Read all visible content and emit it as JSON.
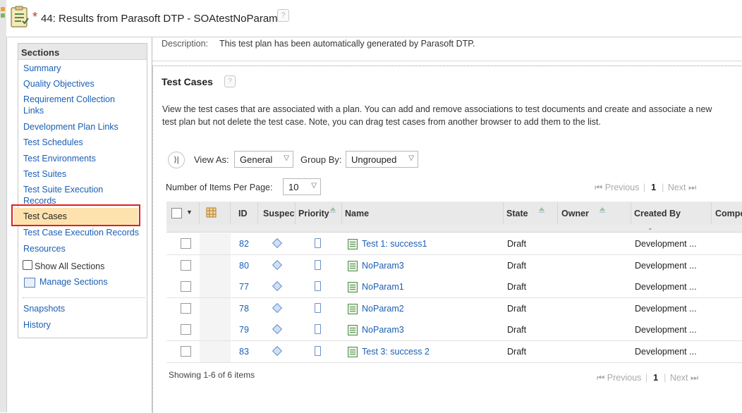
{
  "header": {
    "modified_mark": "*",
    "title": "44: Results from Parasoft DTP - SOAtestNoParam",
    "help": "?"
  },
  "sidebar": {
    "title": "Sections",
    "items": [
      {
        "label": "Summary"
      },
      {
        "label": "Quality Objectives"
      },
      {
        "label": "Requirement Collection"
      },
      {
        "label": "Links"
      },
      {
        "label": "Development Plan Links"
      },
      {
        "label": "Test Schedules"
      },
      {
        "label": "Test Environments"
      },
      {
        "label": "Test Suites"
      },
      {
        "label": "Test Suite Execution"
      },
      {
        "label": "Records"
      },
      {
        "label": "Test Cases"
      },
      {
        "label": "Test Case Execution Records"
      },
      {
        "label": "Resources"
      }
    ],
    "show_all": "Show All Sections",
    "manage": "Manage Sections",
    "snapshots": "Snapshots",
    "history": "History"
  },
  "description": {
    "label": "Description:",
    "text": "This test plan has been automatically generated by Parasoft DTP."
  },
  "test_cases": {
    "title": "Test Cases",
    "help": "?",
    "desc_line1": "View the test cases that are associated with a plan. You can add and remove associations to test documents and create and associate a new",
    "desc_line2": "test plan but not delete the test case. Note, you can drag test cases from another browser to add them to the list.",
    "collapse_glyph": "⟩|",
    "view_as_label": "View As:",
    "view_as_value": "General",
    "group_by_label": "Group By:",
    "group_by_value": "Ungrouped",
    "per_page_label": "Number of Items Per Page:",
    "per_page_value": "10",
    "pager": {
      "first": "⏮",
      "previous": "Previous",
      "page": "1",
      "next": "Next",
      "last": "⏭"
    },
    "columns": {
      "id": "ID",
      "suspect": "Suspect",
      "priority": "Priority",
      "name": "Name",
      "state": "State",
      "owner": "Owner",
      "created_by": "Created By",
      "component": "Compo"
    },
    "rows": [
      {
        "id": "82",
        "name": "Test 1: success1",
        "state": "Draft",
        "created_by": "Development ..."
      },
      {
        "id": "80",
        "name": "NoParam3",
        "state": "Draft",
        "created_by": "Development ..."
      },
      {
        "id": "77",
        "name": "NoParam1",
        "state": "Draft",
        "created_by": "Development ..."
      },
      {
        "id": "78",
        "name": "NoParam2",
        "state": "Draft",
        "created_by": "Development ..."
      },
      {
        "id": "79",
        "name": "NoParam3",
        "state": "Draft",
        "created_by": "Development ..."
      },
      {
        "id": "83",
        "name": "Test 3: success 2",
        "state": "Draft",
        "created_by": "Development ..."
      }
    ],
    "showing": "Showing 1-6 of 6 items"
  },
  "colors": {
    "link": "#1a5fb4",
    "highlight": "#fde2ae",
    "annotation": "#e02020"
  }
}
